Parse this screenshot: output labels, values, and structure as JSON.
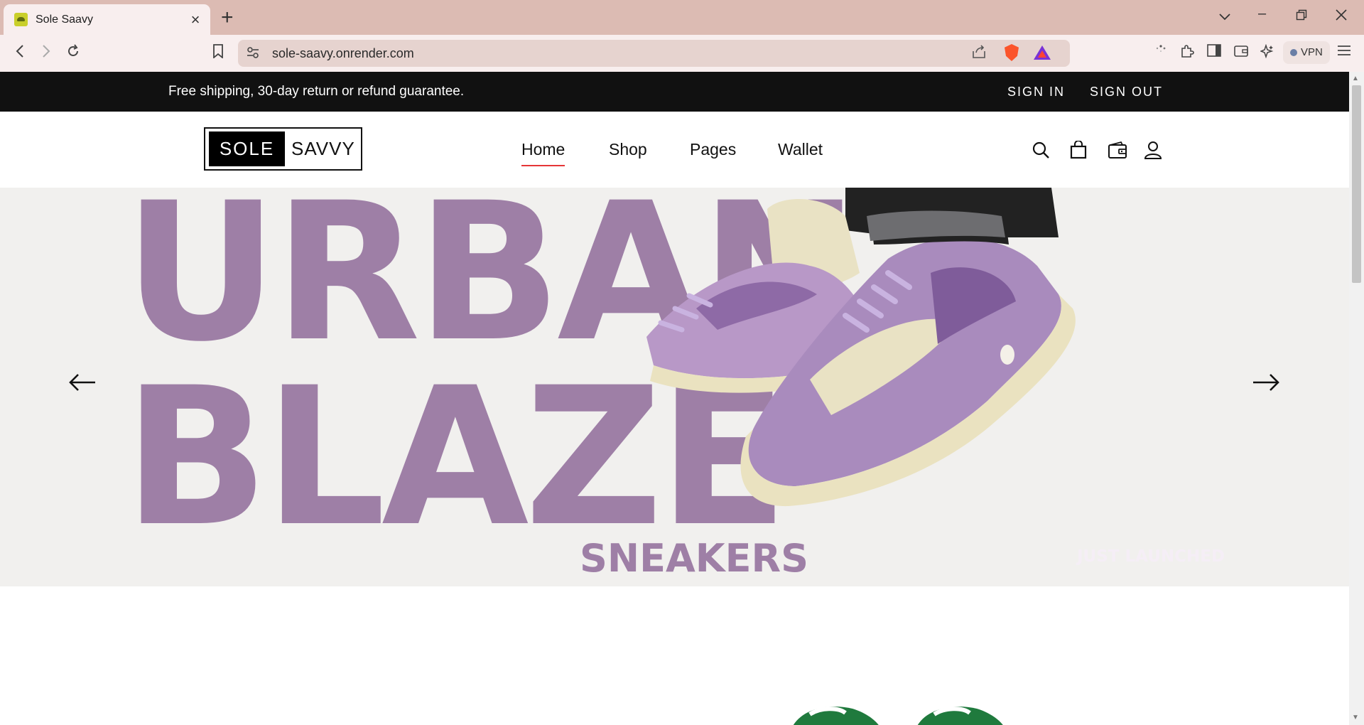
{
  "browser": {
    "tab_title": "Sole Saavy",
    "url": "sole-saavy.onrender.com",
    "vpn_label": "VPN"
  },
  "announcement": {
    "text": "Free shipping, 30-day return or refund guarantee.",
    "sign_in": "SIGN IN",
    "sign_out": "SIGN OUT"
  },
  "logo": {
    "part1": "SOLE",
    "part2": "SAVVY"
  },
  "nav": {
    "items": [
      "Home",
      "Shop",
      "Pages",
      "Wallet"
    ],
    "active": "Home"
  },
  "hero": {
    "line1": "URBAN",
    "line2": "BLAZE",
    "sub_left": "SNEAKERS",
    "sub_right": "JUST LAUNCHED"
  },
  "colors": {
    "hero_text": "#9e7fa6",
    "hero_bg": "#f1f0ee",
    "accent": "#e53637",
    "announce_bg": "#111111",
    "tabbar": "#dcbbb3"
  },
  "icons": [
    "search-icon",
    "shopping-bag-icon",
    "wallet-icon",
    "user-icon",
    "arrow-left-icon",
    "arrow-right-icon"
  ]
}
